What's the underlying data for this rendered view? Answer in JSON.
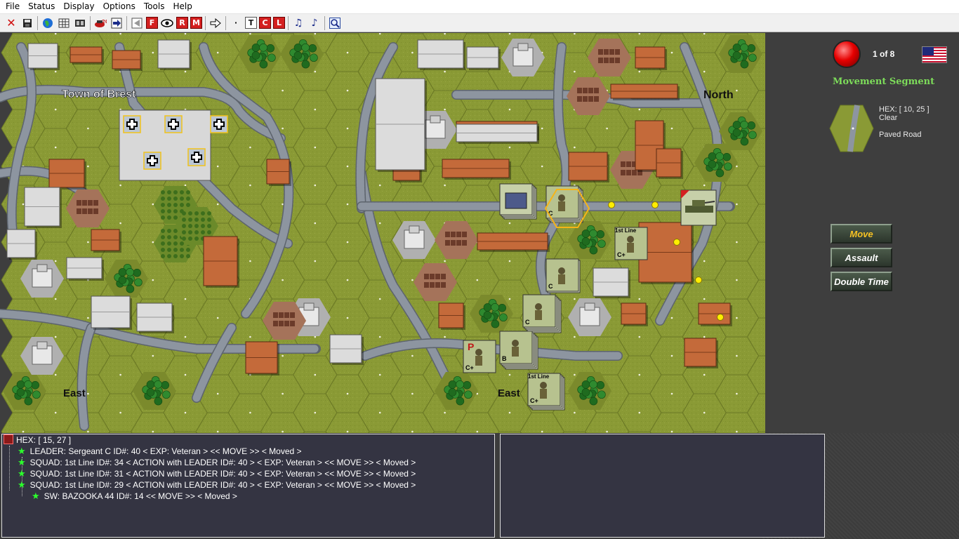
{
  "menu": [
    "File",
    "Status",
    "Display",
    "Options",
    "Tools",
    "Help"
  ],
  "toolbar": {
    "icons": [
      "close-icon",
      "save-icon",
      "globe-icon",
      "grid-icon",
      "film-icon",
      "fire-icon",
      "next-unit-icon",
      "prev-icon",
      "fire-mode-icon",
      "eye-icon",
      "rout-icon",
      "melee-icon",
      "arrow-icon",
      "dot-icon",
      "text-icon",
      "contour-icon",
      "label-icon",
      "music-note-icon",
      "music-icon",
      "search-icon"
    ],
    "letters": {
      "fire": "F",
      "rout": "R",
      "melee": "M",
      "text": "T",
      "contour": "C",
      "label": "L"
    }
  },
  "map": {
    "labels": [
      "Town of Brest",
      "North",
      "East",
      "East"
    ],
    "counter_labels": [
      "1st Line",
      "C",
      "C+",
      "B",
      "P"
    ]
  },
  "side": {
    "turn": "1 of 8",
    "segment": "Movement Segment",
    "hex": "HEX: [ 10, 25 ]",
    "terrain": "Clear",
    "road": "Paved Road",
    "buttons": [
      "Move",
      "Assault",
      "Double Time"
    ]
  },
  "info": {
    "hex": "HEX: [ 15, 27 ]",
    "lines": [
      "LEADER: Sergeant C   ID#: 40 < EXP: Veteran >   << MOVE >>   < Moved >",
      "SQUAD: 1st Line   ID#: 34  < ACTION with LEADER ID#: 40 >  < EXP: Veteran >   << MOVE >>   < Moved >",
      "SQUAD: 1st Line   ID#: 31  < ACTION with LEADER ID#: 40 >  < EXP: Veteran >   << MOVE >>   < Moved >",
      "SQUAD: 1st Line   ID#: 29  < ACTION with LEADER ID#: 40 >  < EXP: Veteran >   << MOVE >>   < Moved >",
      "SW: BAZOOKA 44  ID#: 14  << MOVE >>   < Moved >"
    ]
  },
  "colors": {
    "grass": "#8a9a35",
    "road": "#8d95a0",
    "town": "#d8d8d8",
    "panel": "#343442",
    "segment": "#7ddc5a",
    "move_active": "#f6c223"
  }
}
